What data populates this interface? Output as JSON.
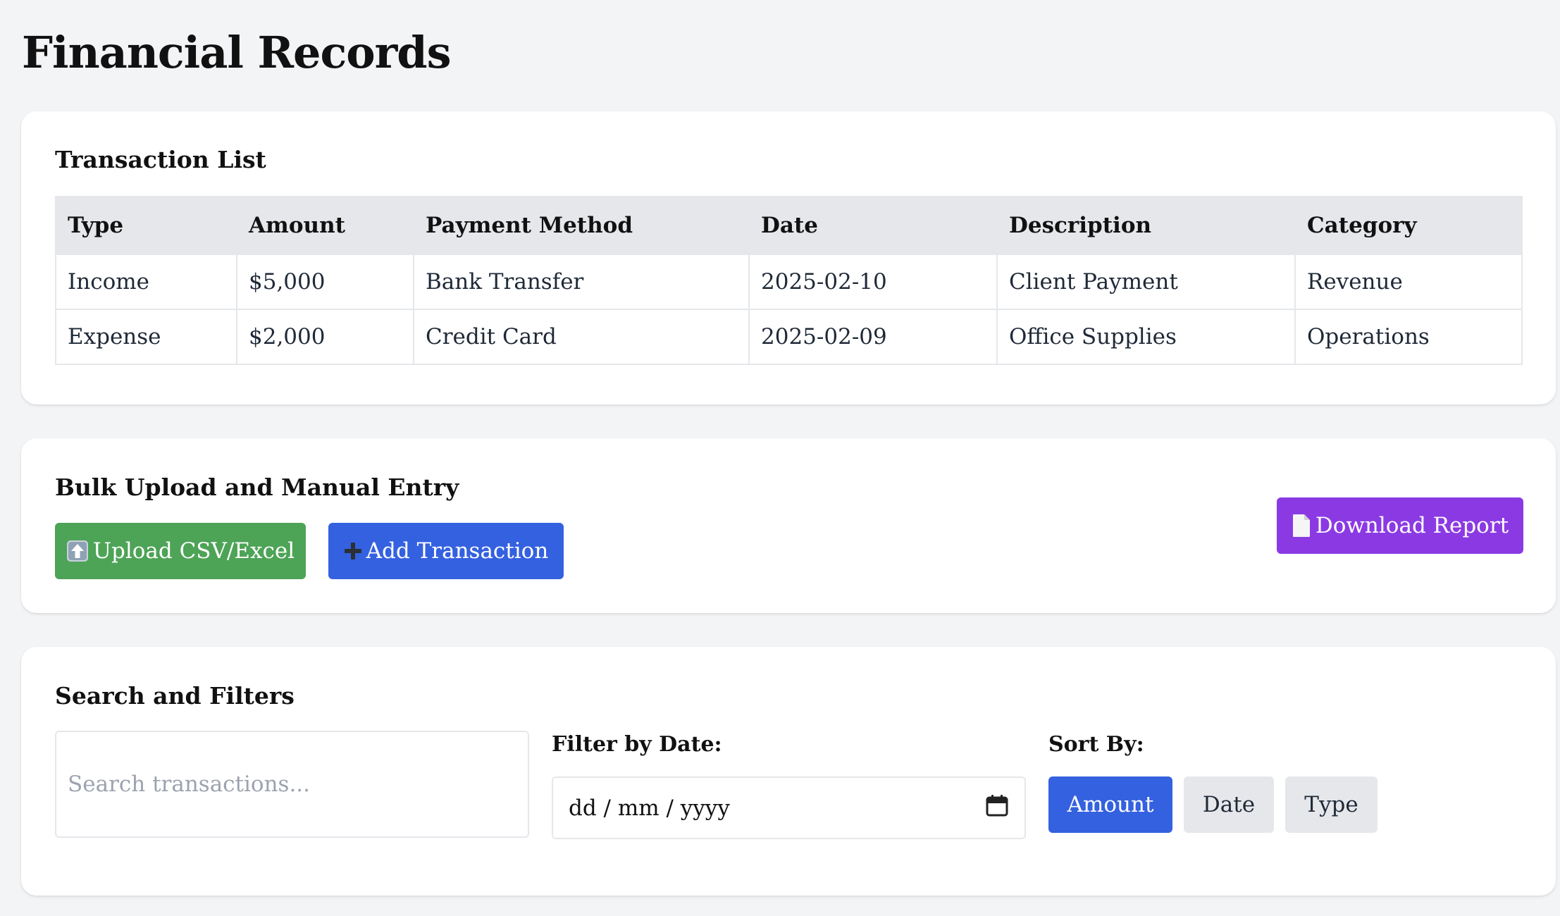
{
  "page": {
    "title": "Financial Records"
  },
  "transactions": {
    "heading": "Transaction List",
    "columns": [
      "Type",
      "Amount",
      "Payment Method",
      "Date",
      "Description",
      "Category"
    ],
    "rows": [
      [
        "Income",
        "$5,000",
        "Bank Transfer",
        "2025-02-10",
        "Client Payment",
        "Revenue"
      ],
      [
        "Expense",
        "$2,000",
        "Credit Card",
        "2025-02-09",
        "Office Supplies",
        "Operations"
      ]
    ]
  },
  "bulk": {
    "heading": "Bulk Upload and Manual Entry",
    "upload_label": "Upload CSV/Excel",
    "upload_icon": "upload-arrow-icon",
    "add_label": "Add Transaction",
    "add_icon": "plus-icon",
    "download_label": "Download Report",
    "download_icon": "document-icon"
  },
  "filters": {
    "heading": "Search and Filters",
    "search_placeholder": "Search transactions...",
    "search_value": "",
    "date_label": "Filter by Date:",
    "date_placeholder": "dd / mm / yyyy",
    "date_icon": "calendar-icon",
    "sort_label": "Sort By:",
    "sort_options": [
      "Amount",
      "Date",
      "Type"
    ],
    "sort_selected": "Amount"
  },
  "colors": {
    "background": "#f3f4f6",
    "upload_button": "#4da356",
    "add_button": "#3461e0",
    "download_button": "#8b3ae3",
    "sort_active": "#3461e0",
    "sort_inactive": "#e5e7eb"
  }
}
